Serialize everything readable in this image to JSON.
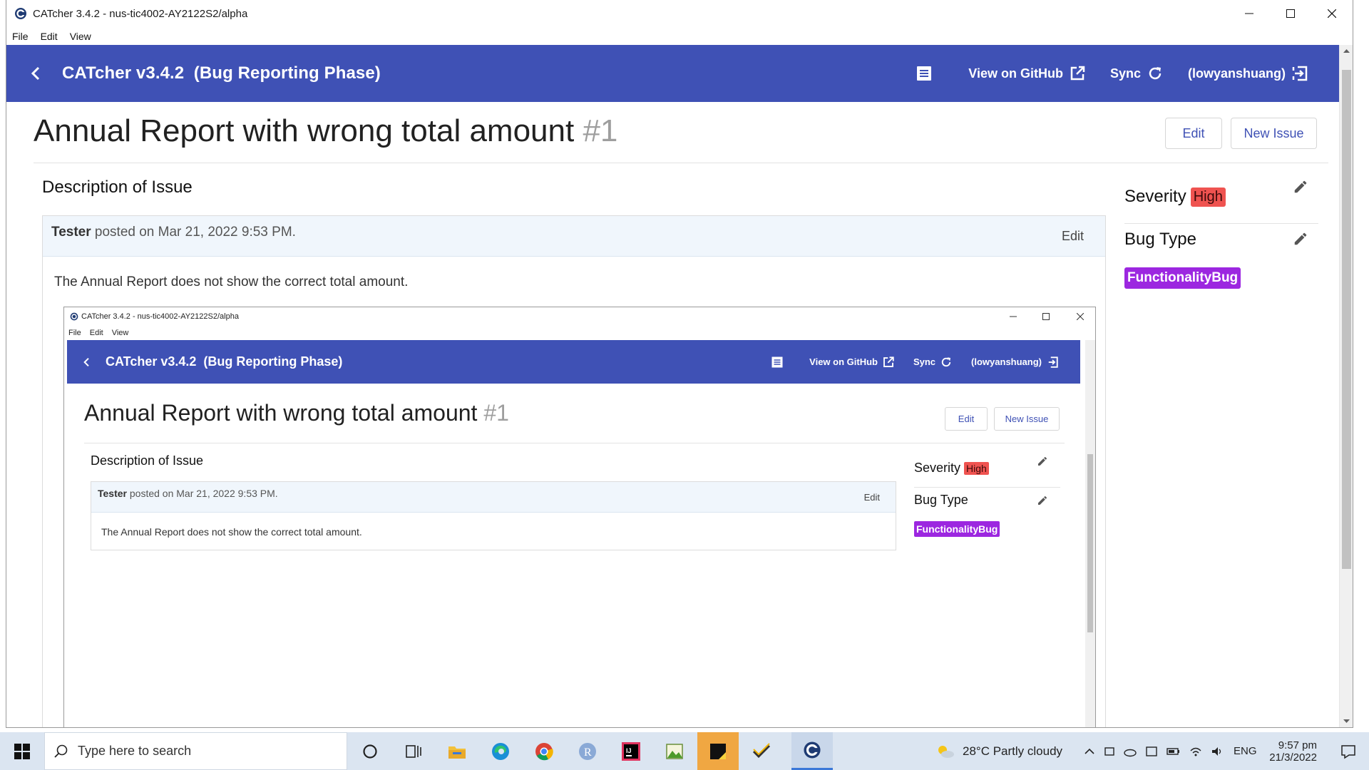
{
  "window": {
    "title": "CATcher 3.4.2 - nus-tic4002-AY2122S2/alpha",
    "menu": [
      "File",
      "Edit",
      "View"
    ]
  },
  "appbar": {
    "title": "CATcher v3.4.2  (Bug Reporting Phase)",
    "view_github": "View on GitHub",
    "sync": "Sync",
    "user": "(lowyanshuang)"
  },
  "issue": {
    "title": "Annual Report with wrong total amount",
    "number": "#1",
    "edit_button": "Edit",
    "new_issue_button": "New Issue",
    "description_heading": "Description of Issue",
    "comment": {
      "author": "Tester",
      "posted": "posted on Mar 21, 2022 9:53 PM.",
      "edit": "Edit",
      "body": "The Annual Report does not show the correct total amount."
    }
  },
  "sidebar": {
    "severity_label": "Severity",
    "severity_value": "High",
    "bug_type_label": "Bug Type",
    "bug_type_value": "FunctionalityBug"
  },
  "taskbar": {
    "search_placeholder": "Type here to search",
    "weather": "28°C  Partly cloudy",
    "language": "ENG",
    "time": "9:57 pm",
    "date": "21/3/2022"
  },
  "colors": {
    "appbar": "#3f51b5",
    "severity_high": "#ef5350",
    "functionality_bug": "#9c27e0"
  }
}
